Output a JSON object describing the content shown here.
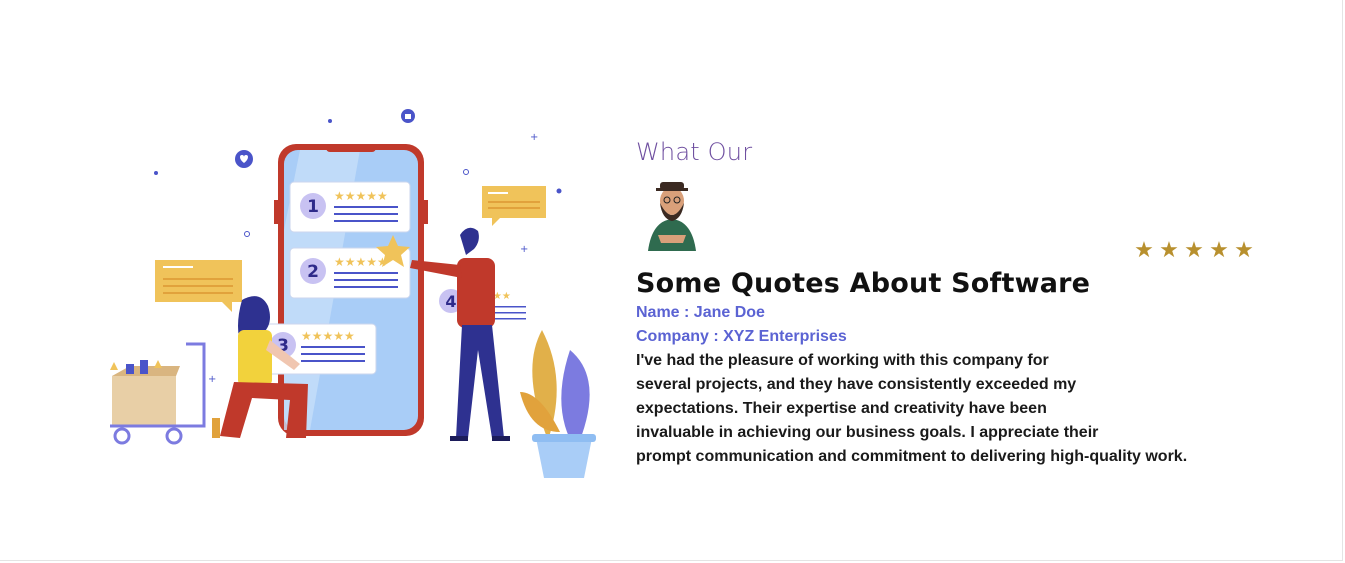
{
  "section": {
    "heading_small": "What Our",
    "title": "Some Quotes About Software",
    "name_label": "Name : Jane Doe",
    "company_label": "Company : XYZ Enterprises",
    "quote_lines": [
      "I've had the pleasure of working with this company for",
      "several projects, and they have consistently exceeded my",
      "expectations. Their expertise and creativity have been",
      "invaluable in achieving our business goals. I appreciate their",
      "prompt communication and commitment to delivering high-quality work."
    ],
    "rating": 5,
    "star_glyph": "★"
  },
  "illustration": {
    "step_numbers": [
      "1",
      "2",
      "3",
      "4"
    ],
    "icons": [
      "heart-icon",
      "thumbs-up-icon",
      "star-icon"
    ]
  },
  "colors": {
    "heading": "#6f4fa0",
    "meta": "#5b63d3",
    "star": "#b8902e",
    "phone": "#c0392b",
    "accent_yellow": "#f0c35a"
  }
}
